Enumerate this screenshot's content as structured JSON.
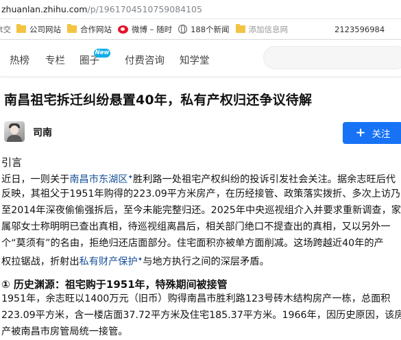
{
  "browser": {
    "url_host": "zhuanlan.zhihu.com",
    "url_path": "/p/1961704510759084105"
  },
  "bookmarks": {
    "first_partial": "t交",
    "items": [
      {
        "label": "公司网站",
        "icon": "folder-icon"
      },
      {
        "label": "合作网站",
        "icon": "folder-icon"
      },
      {
        "label": "微博 – 随时",
        "icon": "weibo-icon"
      },
      {
        "label": "188个新闻",
        "icon": "globe-icon"
      },
      {
        "label": "添加信息网",
        "icon": "folder-icon"
      }
    ],
    "phone": "2123596984"
  },
  "nav": {
    "items": [
      "热榜",
      "专栏",
      "圈子",
      "付费咨询",
      "知学堂"
    ],
    "new_badge": "New"
  },
  "article": {
    "title": "南昌祖宅拆迁纠纷悬置40年，私有产权归还争议待解",
    "author": "司南",
    "follow_label": "关注",
    "intro_label": "引言",
    "intro_lines": [
      {
        "pre": "近日，一则关于",
        "link": "南昌市东湖区",
        "post": "胜利路一处祖宅产权纠纷的投诉引发社会关注。据余志旺后代"
      },
      {
        "text": "反映，其祖父于1951年购得的223.09平方米房产，在历经接管、政策落实拨折、多次上访乃"
      },
      {
        "text": "至2014年深夜偷偷强拆后，至今未能完整归还。2025年中央巡视组介入并要求重新调查，家"
      },
      {
        "text": "属邬女士称明明已查出真相，待巡视组离昌后，相关部门绝口不提查出的真相，又以另外一"
      },
      {
        "text": "个“莫须有”的名由，拒绝归还店面部分。住宅面积亦被单方面削减。这场跨越近40年的产"
      },
      {
        "pre": "权拉锯战，折射出",
        "link": "私有财产保护",
        "post": "与地方执行之间的深层矛盾。"
      }
    ],
    "section1_heading": "① 历史渊源：祖宅购于1951年，特殊期间被接管",
    "section1_lines": [
      "1951年，余志旺以1400万元（旧币）购得南昌市胜利路123号砖木结构房产一栋，总面积",
      "223.09平方米，含一楼店面37.72平方米及住宅185.37平方米。1966年，因历史原因，该房",
      "产被南昌市房管局统一接管。"
    ]
  }
}
